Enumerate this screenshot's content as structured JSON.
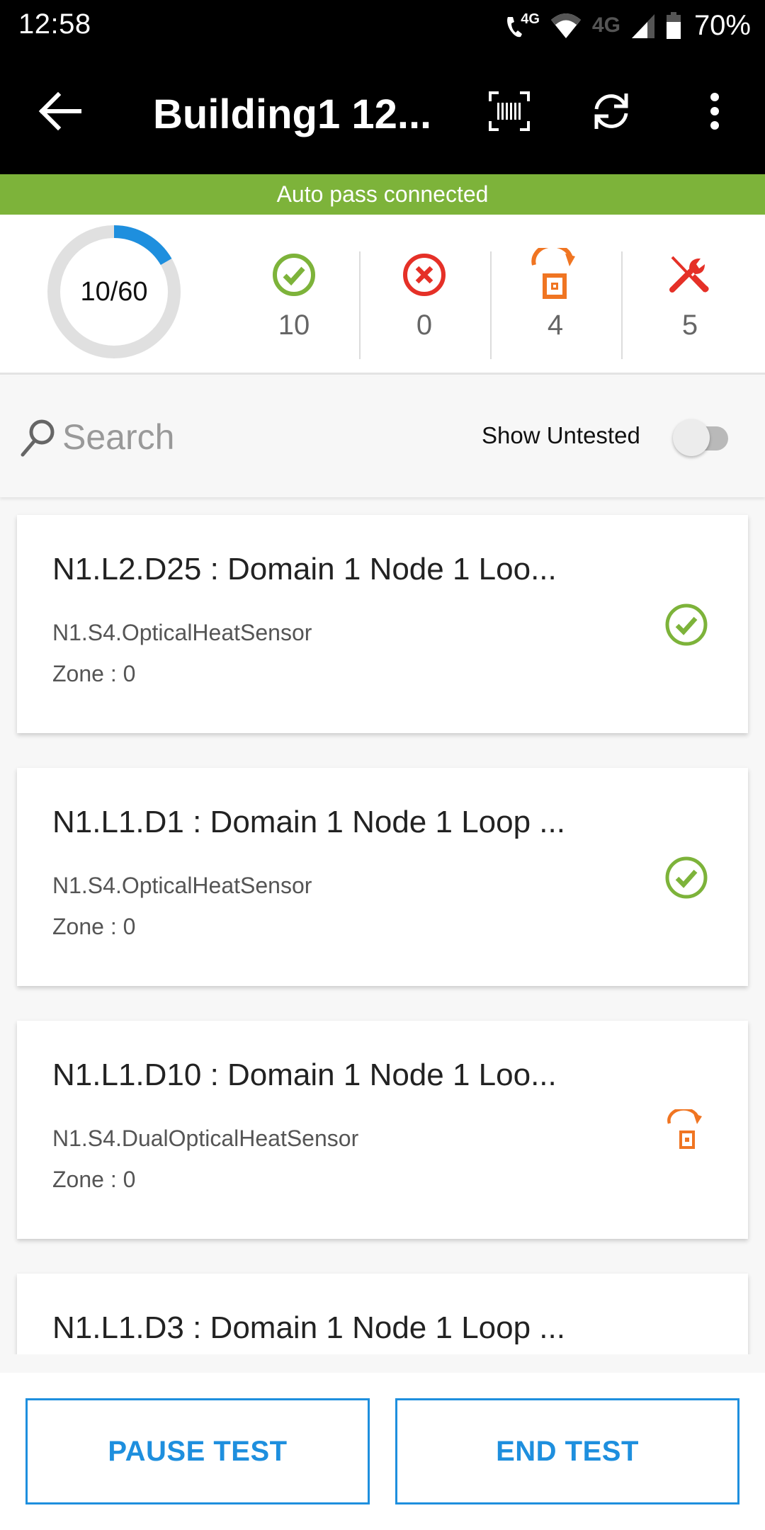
{
  "status_bar": {
    "time": "12:58",
    "call_network": "4G",
    "data_network": "4G",
    "battery_percent": "70%",
    "icons": [
      "volte-call-icon",
      "wifi-icon",
      "signal-icon",
      "battery-icon"
    ]
  },
  "app_bar": {
    "title": "Building1 12...",
    "icons": {
      "back": "arrow-left-icon",
      "scan": "barcode-scan-icon",
      "refresh": "refresh-icon",
      "more": "more-vert-icon"
    }
  },
  "banner": {
    "text": "Auto pass connected",
    "color": "#7db33a"
  },
  "stats": {
    "progress": {
      "label": "10/60",
      "tested": 10,
      "total": 60,
      "fraction": 0.1667,
      "color": "#1e8fde",
      "track_color": "#e0e0e0"
    },
    "items": [
      {
        "name": "passed",
        "icon": "check-circle-icon",
        "count": "10",
        "color": "#7db33a"
      },
      {
        "name": "failed",
        "icon": "x-circle-icon",
        "count": "0",
        "color": "#e53027"
      },
      {
        "name": "skipped",
        "icon": "skip-device-icon",
        "count": "4",
        "color": "#f07522"
      },
      {
        "name": "faults",
        "icon": "tools-icon",
        "count": "5",
        "color": "#e53027"
      }
    ]
  },
  "search": {
    "placeholder": "Search",
    "value": "",
    "toggle_label": "Show Untested",
    "toggle_on": false
  },
  "devices": [
    {
      "title": "N1.L2.D25 : Domain 1 Node 1 Loo...",
      "type": "N1.S4.OpticalHeatSensor",
      "zone": "Zone : 0",
      "status": "passed"
    },
    {
      "title": "N1.L1.D1 : Domain 1 Node 1 Loop ...",
      "type": "N1.S4.OpticalHeatSensor",
      "zone": "Zone : 0",
      "status": "passed"
    },
    {
      "title": "N1.L1.D10 : Domain 1 Node 1 Loo...",
      "type": "N1.S4.DualOpticalHeatSensor",
      "zone": "Zone : 0",
      "status": "skipped"
    },
    {
      "title": "N1.L1.D3 : Domain 1 Node 1 Loop ...",
      "type": "",
      "zone": "",
      "status": ""
    }
  ],
  "actions": {
    "pause_label": "PAUSE TEST",
    "end_label": "END TEST",
    "accent": "#1e8fde"
  }
}
